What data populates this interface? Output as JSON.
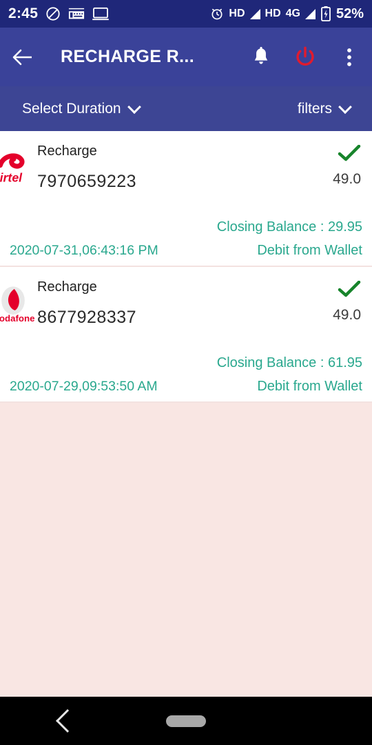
{
  "status_bar": {
    "time": "2:45",
    "left_icons": [
      "do-not-disturb-icon",
      "keyboard-icon",
      "cast-screen-icon"
    ],
    "alarm_icon": "alarm-icon",
    "hd1_label": "HD",
    "hd2_label": "HD",
    "network_label": "4G",
    "battery_percent": "52%",
    "background": "#1f2779"
  },
  "app_bar": {
    "back_icon": "back-arrow-icon",
    "title": "RECHARGE R...",
    "notification_icon": "bell-icon",
    "power_icon": "power-icon",
    "overflow_icon": "more-vertical-icon",
    "background": "#3a4299",
    "power_color": "#e01b2e"
  },
  "filter_bar": {
    "duration_label": "Select Duration",
    "filters_label": "filters",
    "background": "#3d4594"
  },
  "transactions": [
    {
      "operator": "airtel",
      "type_label": "Recharge",
      "mobile": "7970659223",
      "status_icon": "green-check-icon",
      "amount": "49.0",
      "datetime": "2020-07-31,06:43:16 PM",
      "closing_balance": "Closing Balance : 29.95",
      "source": "Debit from Wallet"
    },
    {
      "operator": "vodafone",
      "type_label": "Recharge",
      "mobile": "8677928337",
      "status_icon": "green-check-icon",
      "amount": "49.0",
      "datetime": "2020-07-29,09:53:50 AM",
      "closing_balance": "Closing Balance : 61.95",
      "source": "Debit from Wallet"
    }
  ],
  "colors": {
    "teal_text": "#2aa88e",
    "check_green": "#17842b",
    "list_background": "#f9e6e3"
  },
  "nav_bar": {
    "back_icon": "nav-back-icon",
    "home_icon": "nav-home-pill"
  }
}
